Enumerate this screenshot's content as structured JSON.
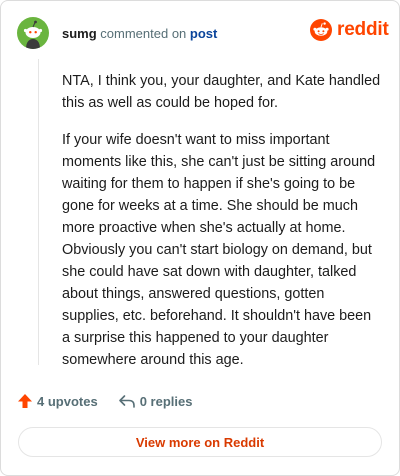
{
  "header": {
    "username": "sumg",
    "commented_on": "commented on",
    "post_link": "post",
    "brand": "reddit",
    "brand_color": "#ff4500"
  },
  "comment": {
    "paragraphs": [
      "NTA, I think you, your daughter, and Kate handled this as well as could be hoped for.",
      "If your wife doesn't want to miss important moments like this, she can't just be sitting around waiting for them to happen if she's going to be gone for weeks at a time. She should be much more proactive when she's actually at home. Obviously you can't start biology on demand, but she could have sat down with daughter, talked about things, answered questions, gotten supplies, etc. beforehand. It shouldn't have been a surprise this happened to your daughter somewhere around this age."
    ]
  },
  "actions": {
    "upvotes": "4 upvotes",
    "replies": "0 replies",
    "upvote_icon": "upvote-arrow-icon",
    "reply_icon": "reply-arrow-icon"
  },
  "footer": {
    "view_more": "View more on Reddit"
  },
  "colors": {
    "avatar_bg": "#6ab53f",
    "upvote": "#ff4500",
    "link_red": "#d93a00",
    "post_link": "#0a449b"
  }
}
